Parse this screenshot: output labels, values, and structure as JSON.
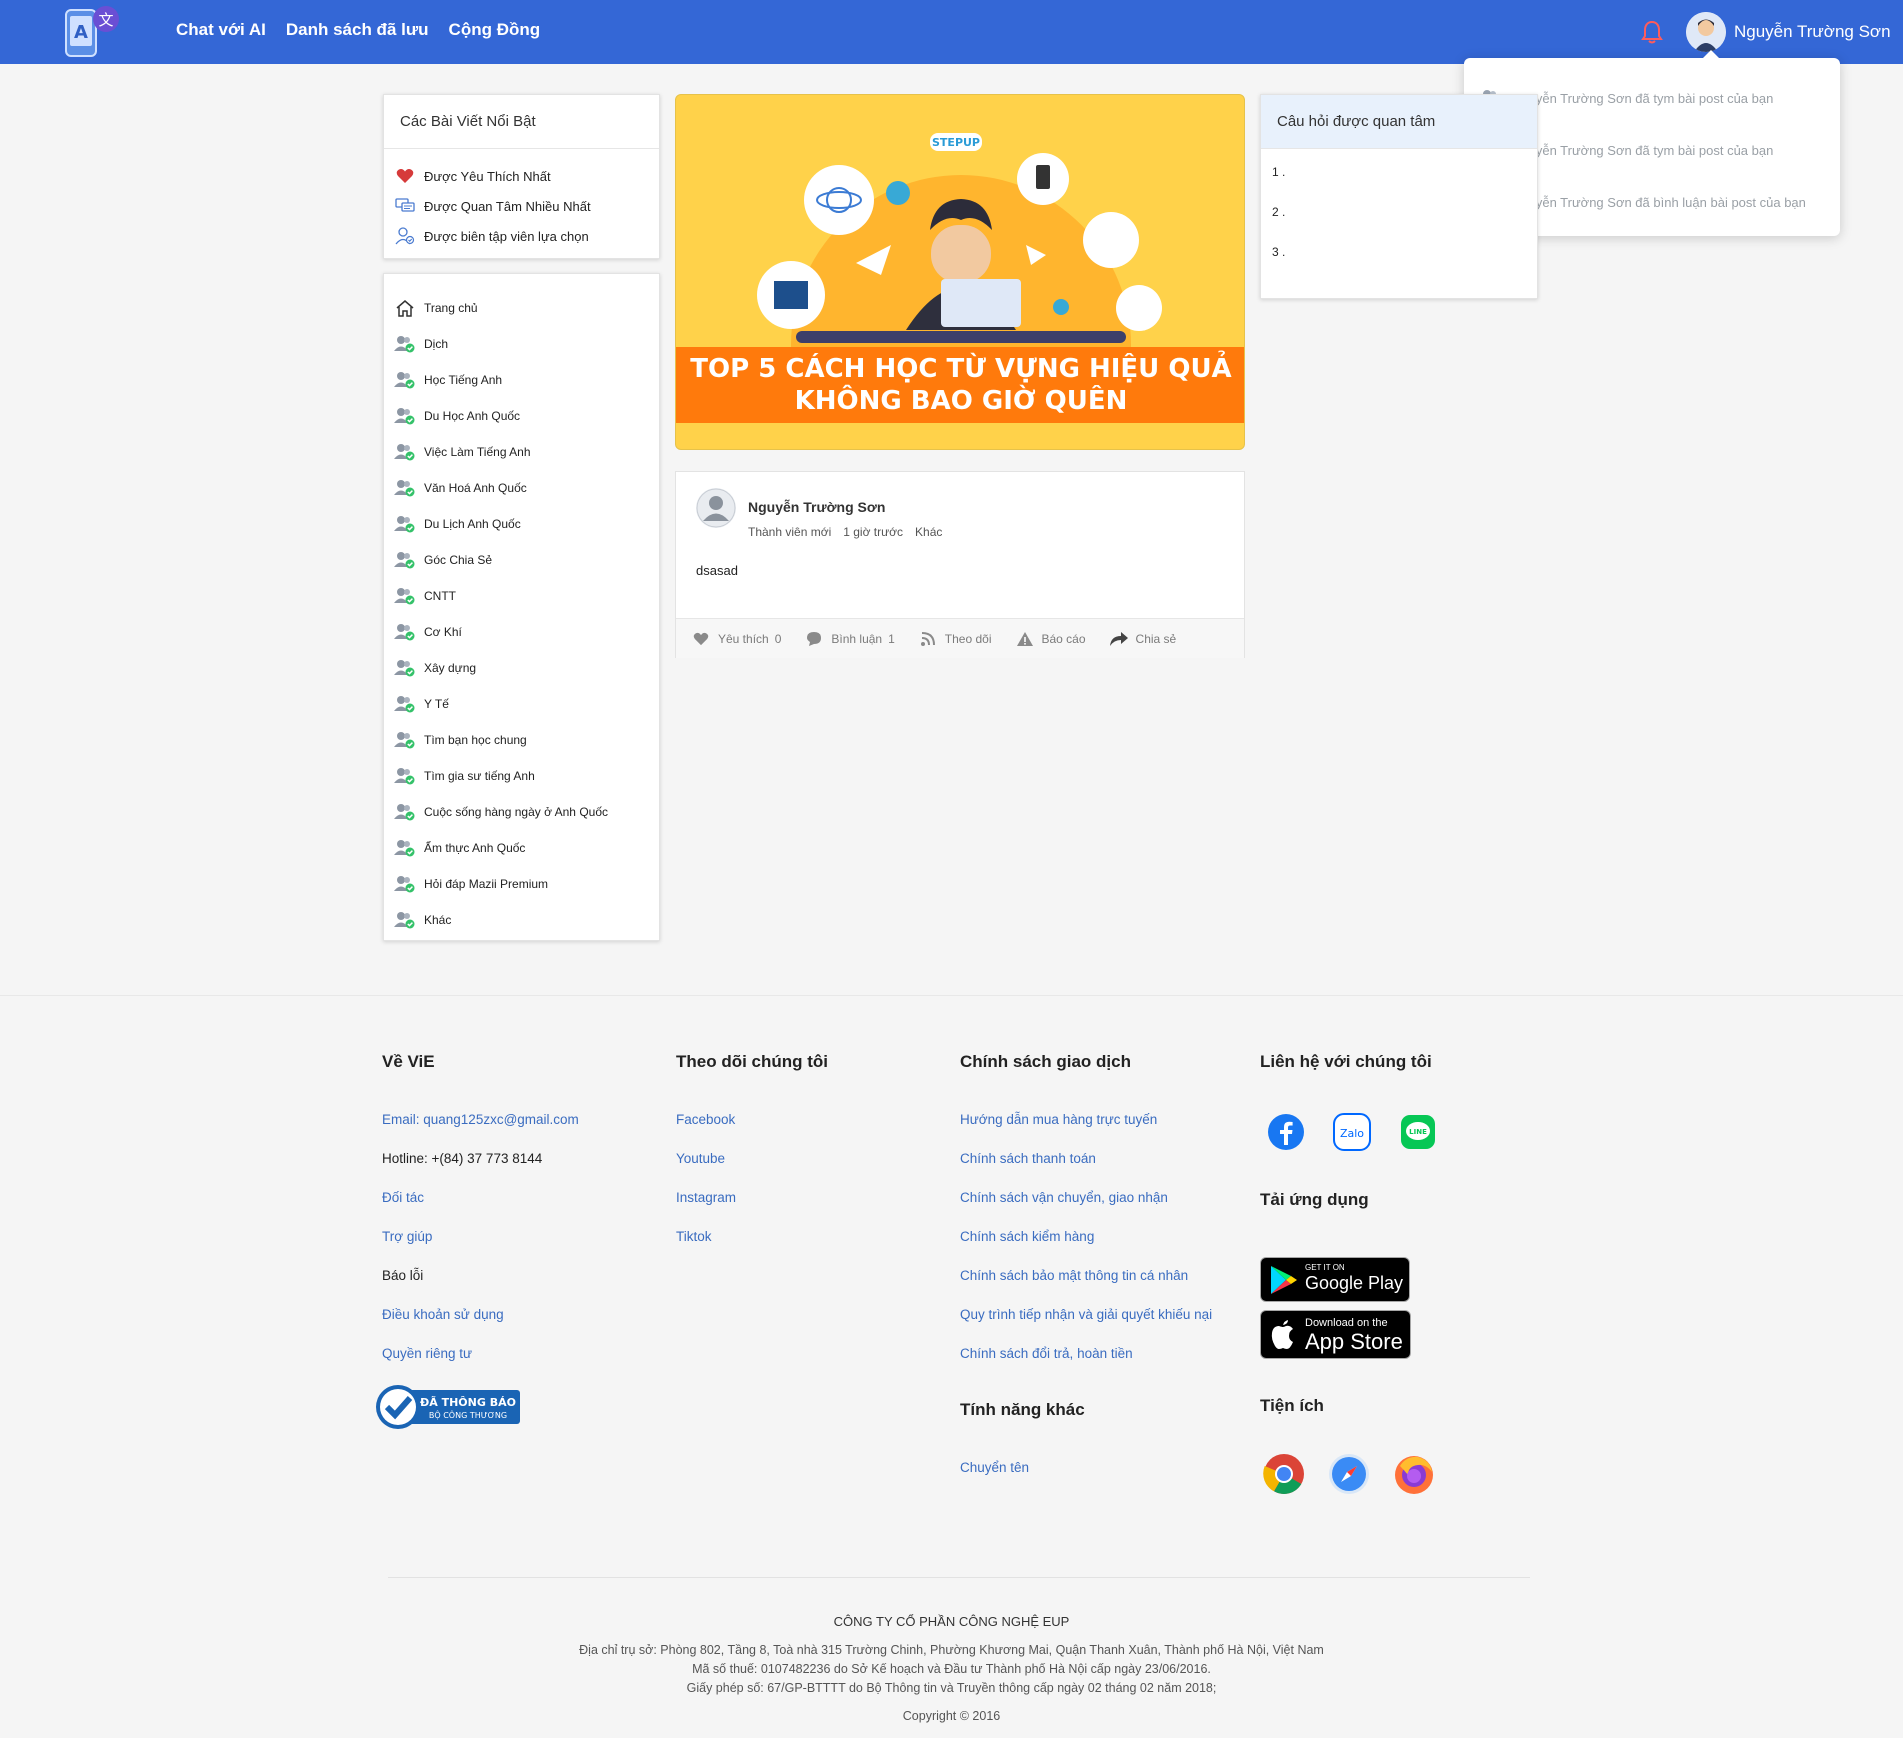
{
  "header": {
    "nav": [
      "Chat với AI",
      "Danh sách đã lưu",
      "Cộng Đồng"
    ],
    "user_name": "Nguyễn Trường Sơn",
    "accent": "#3467d6"
  },
  "notifications": [
    "Nguyễn Trường Sơn đã tym bài post của bạn",
    "Nguyễn Trường Sơn đã tym bài post của bạn",
    "Nguyễn Trường Sơn đã bình luận bài post của bạn"
  ],
  "featured": {
    "title": "Các Bài Viết Nổi Bật",
    "items": [
      {
        "label": "Được Yêu Thích Nhất",
        "icon": "heart-icon"
      },
      {
        "label": "Được Quan Tâm Nhiều Nhất",
        "icon": "chat-icon"
      },
      {
        "label": "Được biên tập viên lựa chọn",
        "icon": "user-check-icon"
      }
    ]
  },
  "categories": [
    "Trang chủ",
    "Dịch",
    "Học Tiếng Anh",
    "Du Học Anh Quốc",
    "Việc Làm Tiếng Anh",
    "Văn Hoá Anh Quốc",
    "Du Lịch Anh Quốc",
    "Góc Chia Sẻ",
    "CNTT",
    "Cơ Khí",
    "Xây dựng",
    "Y Tế",
    "Tìm bạn học chung",
    "Tìm gia sư tiếng Anh",
    "Cuộc sống hàng ngày ở Anh Quốc",
    "Ẩm thực Anh Quốc",
    "Hỏi đáp Mazii Premium",
    "Khác"
  ],
  "banner": {
    "brand": "STEPUP",
    "line1": "TOP 5 CÁCH HỌC TỪ VỰNG HIỆU QUẢ",
    "line2": "KHÔNG BAO GIỜ QUÊN"
  },
  "post": {
    "author": "Nguyễn Trường Sơn",
    "role": "Thành viên mới",
    "time": "1 giờ trước",
    "category": "Khác",
    "content": "dsasad",
    "actions": {
      "like_label": "Yêu thích",
      "like_count": "0",
      "comment_label": "Bình luận",
      "comment_count": "1",
      "follow_label": "Theo dõi",
      "report_label": "Báo cáo",
      "share_label": "Chia sẻ"
    }
  },
  "questions": {
    "title": "Câu hỏi được quan tâm",
    "items": [
      "1 .",
      "2 .",
      "3 ."
    ]
  },
  "footer": {
    "about": {
      "title": "Về ViE",
      "email": "Email: quang125zxc@gmail.com",
      "hotline": "Hotline: +(84) 37 773 8144",
      "partners": "Đối tác",
      "help": "Trợ giúp",
      "report": "Báo lỗi",
      "terms": "Điều khoản sử dụng",
      "privacy": "Quyền riêng tư",
      "badge_line1": "ĐÃ THÔNG BÁO",
      "badge_line2": "BỘ CÔNG THƯƠNG"
    },
    "follow": {
      "title": "Theo dõi chúng tôi",
      "links": [
        "Facebook",
        "Youtube",
        "Instagram",
        "Tiktok"
      ]
    },
    "policy": {
      "title": "Chính sách giao dịch",
      "links": [
        "Hướng dẫn mua hàng trực tuyến",
        "Chính sách thanh toán",
        "Chính sách vận chuyển, giao nhận",
        "Chính sách kiểm hàng",
        "Chính sách bảo mật thông tin cá nhân",
        "Quy trình tiếp nhận và giải quyết khiếu nại",
        "Chính sách đổi trả, hoàn tiền"
      ],
      "other_title": "Tính năng khác",
      "other_link": "Chuyển tên"
    },
    "contact": {
      "title": "Liên hệ với chúng tôi",
      "apps_title": "Tải ứng dụng",
      "google_small": "GET IT ON",
      "google_big": "Google Play",
      "apple_small": "Download on the",
      "apple_big": "App Store",
      "zalo": "Zalo",
      "line": "LINE",
      "utils_title": "Tiện ích"
    },
    "company": "CÔNG TY CỔ PHẦN CÔNG NGHỆ EUP",
    "address": "Địa chỉ trụ sở: Phòng 802, Tầng 8, Toà nhà 315 Trường Chinh, Phường Khương Mai, Quận Thanh Xuân, Thành phố Hà Nội, Việt Nam",
    "tax": "Mã số thuế: 0107482236 do Sở Kế hoạch và Đầu tư Thành phố Hà Nội cấp ngày 23/06/2016.",
    "license": "Giấy phép số: 67/GP-BTTTT do Bộ Thông tin và Truyền thông cấp ngày 02 tháng 02 năm 2018;",
    "copyright": "Copyright © 2016"
  }
}
